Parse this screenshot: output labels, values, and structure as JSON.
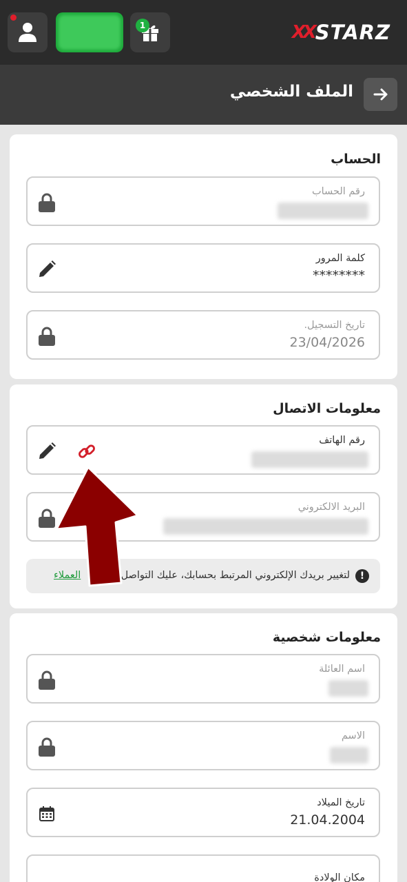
{
  "header": {
    "logo_mark": "XX",
    "logo_text": "STARZ",
    "gift_count": "1"
  },
  "subheader": {
    "title": "الملف الشخصي"
  },
  "account": {
    "title": "الحساب",
    "account_number_label": "رقم الحساب",
    "password_label": "كلمة المرور",
    "password_value": "********",
    "registration_date_label": "تاريخ التسجيل.",
    "registration_date_value": "23/04/2026"
  },
  "contact": {
    "title": "معلومات الاتصال",
    "phone_label": "رقم الهاتف",
    "email_label": "البريد الالكتروني",
    "notice_text": "لتغيير بريدك الإلكتروني المرتبط بحسابك، عليك التواصل",
    "notice_link": "العملاء"
  },
  "personal": {
    "title": "معلومات شخصية",
    "family_name_label": "اسم العائلة",
    "first_name_label": "الاسم",
    "birth_date_label": "تاريخ الميلاد",
    "birth_date_value": "21.04.2004",
    "next_field_label": "مكان الولادة"
  },
  "colors": {
    "accent_red": "#e01e2b",
    "accent_green": "#1fb141",
    "arrow_red": "#8b0000"
  }
}
